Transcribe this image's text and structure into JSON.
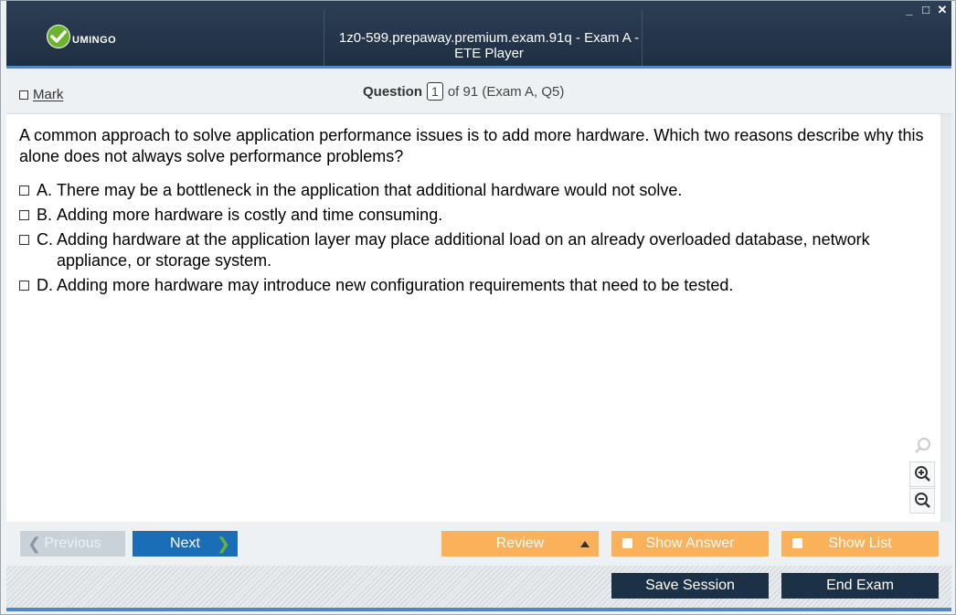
{
  "window": {
    "title": "1z0-599.prepaway.premium.exam.91q - Exam A - ETE Player",
    "controls": [
      "_",
      "□",
      "✕"
    ]
  },
  "brand": {
    "logo_text": "UMINGO",
    "colors": {
      "titlebar": "#24364c",
      "accent": "#4d88c4",
      "check": "#6ab42d"
    }
  },
  "header": {
    "mark_label": "Mark",
    "question_label": "Question",
    "question_number": "1",
    "question_of": "of 91 (Exam A, Q5)"
  },
  "question": {
    "text": "A common approach to solve application performance issues is to add more hardware. Which two reasons describe why this alone does not always solve performance problems?",
    "answers": [
      {
        "letter": "A.",
        "text": "There may be a bottleneck in the application that additional hardware would not solve."
      },
      {
        "letter": "B.",
        "text": "Adding more hardware is costly and time consuming."
      },
      {
        "letter": "C.",
        "text": "Adding hardware at the application layer may place additional load on an already overloaded database, network appliance, or storage system."
      },
      {
        "letter": "D.",
        "text": "Adding more hardware may introduce new configuration requirements that need to be tested."
      }
    ]
  },
  "zoom": {
    "icons": [
      "search-icon",
      "zoom-in-icon",
      "zoom-out-icon"
    ]
  },
  "nav": {
    "previous_label": "Previous",
    "next_label": "Next",
    "review_label": "Review",
    "show_answer_label": "Show Answer",
    "show_list_label": "Show List"
  },
  "footer": {
    "save_label": "Save Session",
    "end_label": "End Exam"
  }
}
